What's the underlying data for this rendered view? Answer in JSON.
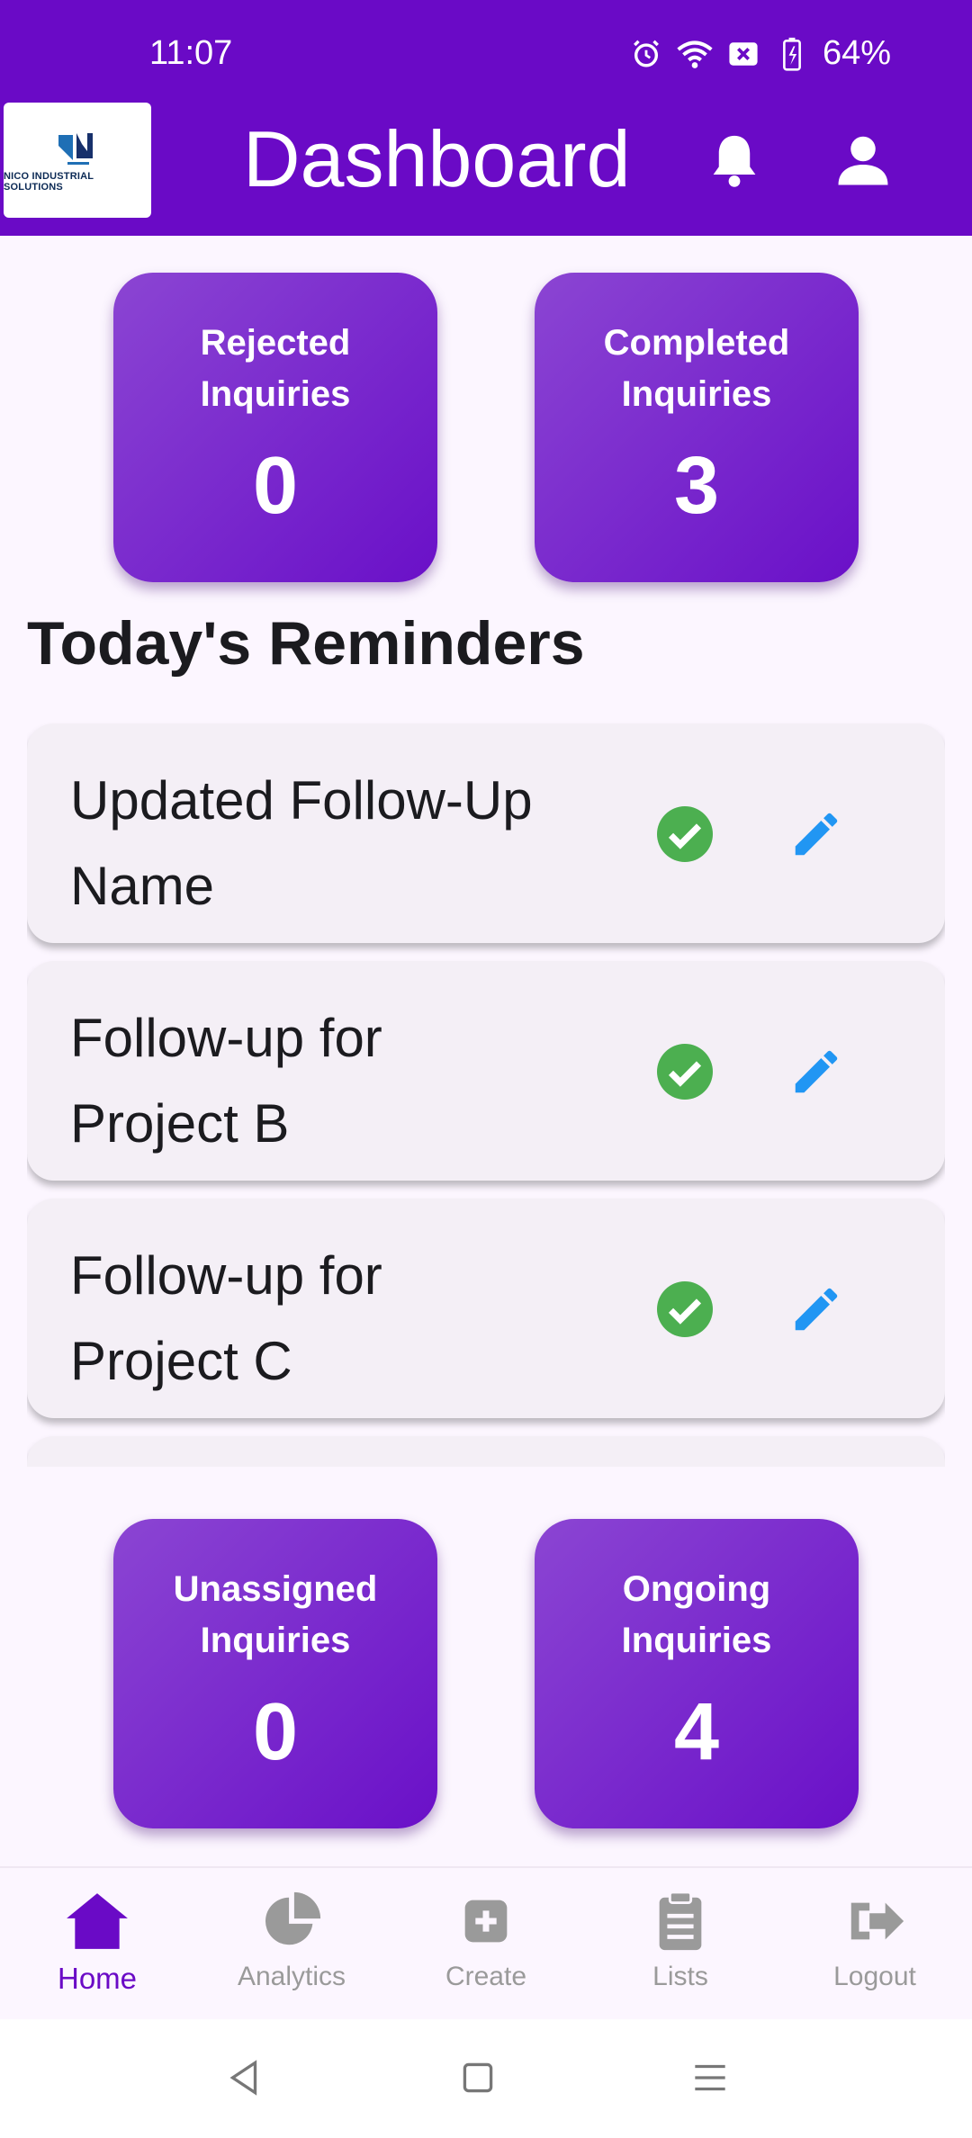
{
  "status_bar": {
    "time": "11:07",
    "battery": "64%",
    "icons": [
      "alarm-icon",
      "wifi-icon",
      "sim-off-icon",
      "battery-charging-icon"
    ]
  },
  "header": {
    "logo_text": "NICO INDUSTRIAL SOLUTIONS",
    "title": "Dashboard",
    "icons": [
      "bell-icon",
      "person-icon"
    ]
  },
  "top_cards": [
    {
      "label": "Rejected Inquiries",
      "value": "0"
    },
    {
      "label": "Completed Inquiries",
      "value": "3"
    }
  ],
  "reminders": {
    "title": "Today's Reminders",
    "items": [
      {
        "text": "Updated Follow-Up Name"
      },
      {
        "text": "Follow-up for Project B"
      },
      {
        "text": "Follow-up for Project C"
      }
    ]
  },
  "bottom_cards": [
    {
      "label": "Unassigned Inquiries",
      "value": "0"
    },
    {
      "label": "Ongoing Inquiries",
      "value": "4"
    }
  ],
  "bottom_nav": {
    "items": [
      {
        "label": "Home",
        "icon": "home-icon",
        "active": true
      },
      {
        "label": "Analytics",
        "icon": "pie-chart-icon",
        "active": false
      },
      {
        "label": "Create",
        "icon": "add-box-icon",
        "active": false
      },
      {
        "label": "Lists",
        "icon": "clipboard-icon",
        "active": false
      },
      {
        "label": "Logout",
        "icon": "logout-icon",
        "active": false
      }
    ]
  },
  "colors": {
    "primary": "#6a0ac6",
    "card_gradient_start": "#8b45d3",
    "check": "#4caf50",
    "edit": "#2196f3",
    "inactive_nav": "#9a9a9a"
  }
}
